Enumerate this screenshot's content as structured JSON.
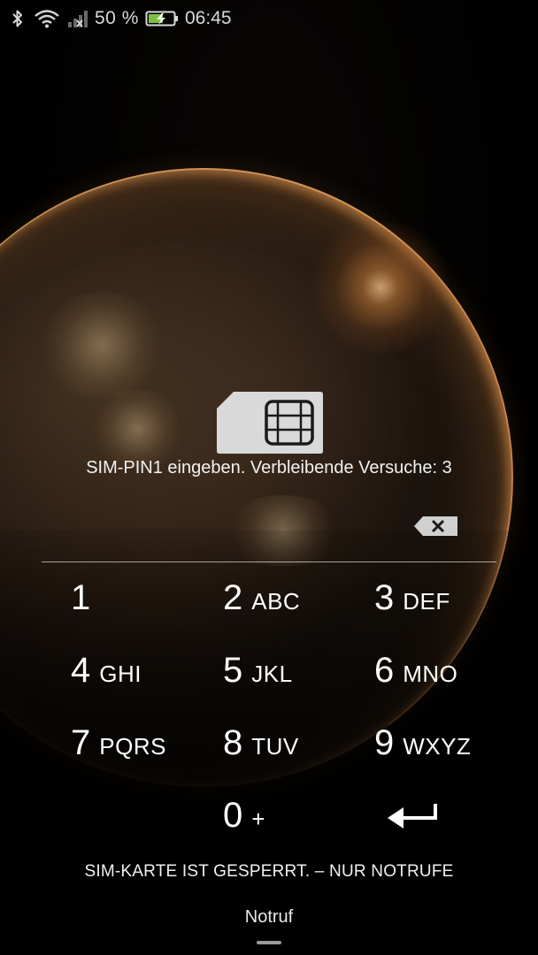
{
  "status_bar": {
    "battery_percent": "50 %",
    "time": "06:45",
    "icons": [
      "bluetooth-icon",
      "wifi-icon",
      "signal-no-sim-icon",
      "battery-charging-icon"
    ]
  },
  "sim_lock": {
    "icon": "sim-card-icon",
    "prompt": "SIM-PIN1 eingeben. Verbleibende Versuche: 3",
    "backspace_icon": "backspace-icon"
  },
  "keypad": {
    "keys": [
      {
        "digit": "1",
        "letters": ""
      },
      {
        "digit": "2",
        "letters": "ABC"
      },
      {
        "digit": "3",
        "letters": "DEF"
      },
      {
        "digit": "4",
        "letters": "GHI"
      },
      {
        "digit": "5",
        "letters": "JKL"
      },
      {
        "digit": "6",
        "letters": "MNO"
      },
      {
        "digit": "7",
        "letters": "PQRS"
      },
      {
        "digit": "8",
        "letters": "TUV"
      },
      {
        "digit": "9",
        "letters": "WXYZ"
      },
      {
        "digit": "0",
        "letters": "+"
      }
    ],
    "enter_icon": "enter-arrow-icon"
  },
  "footer": {
    "locked_message": "SIM-KARTE IST GESPERRT. – NUR NOTRUFE",
    "emergency_label": "Notruf"
  },
  "colors": {
    "text": "#ffffff",
    "background": "#000000",
    "sim_card_fill": "#d9d9d9",
    "battery_charge": "#7ac143"
  }
}
